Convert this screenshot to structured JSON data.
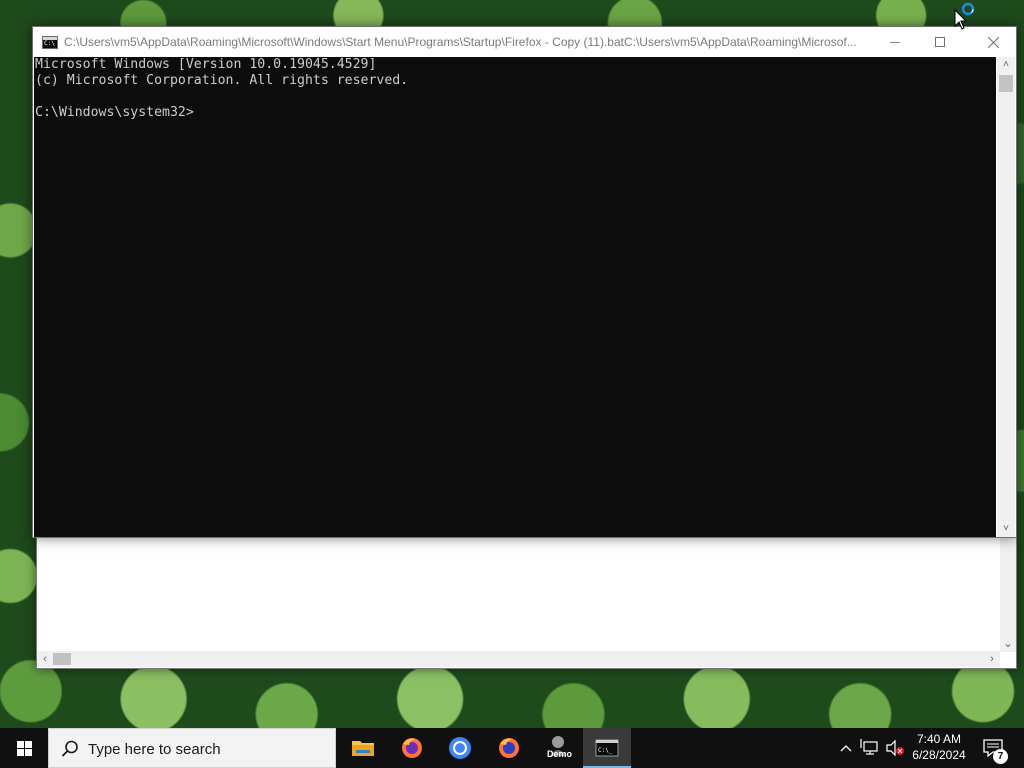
{
  "console_window": {
    "title": "C:\\Users\\vm5\\AppData\\Roaming\\Microsoft\\Windows\\Start Menu\\Programs\\Startup\\Firefox - Copy (11).batC:\\Users\\vm5\\AppData\\Roaming\\Microsof...",
    "lines": [
      "Microsoft Windows [Version 10.0.19045.4529]",
      "(c) Microsoft Corporation. All rights reserved.",
      "",
      "C:\\Windows\\system32>"
    ]
  },
  "taskbar": {
    "search_placeholder": "Type here to search",
    "apps": [
      {
        "name": "file-explorer",
        "active": false
      },
      {
        "name": "firefox",
        "active": false
      },
      {
        "name": "chrome",
        "active": false
      },
      {
        "name": "firefox",
        "active": false
      },
      {
        "name": "demo",
        "label": "Demo",
        "active": false
      },
      {
        "name": "command-prompt",
        "active": true
      }
    ],
    "clock": {
      "time": "7:40 AM",
      "date": "6/28/2024"
    },
    "notification_count": "7"
  },
  "colors": {
    "console_bg": "#0c0c0c",
    "console_fg": "#cccccc",
    "taskbar_bg": "#101010",
    "accent": "#76b9ed"
  }
}
